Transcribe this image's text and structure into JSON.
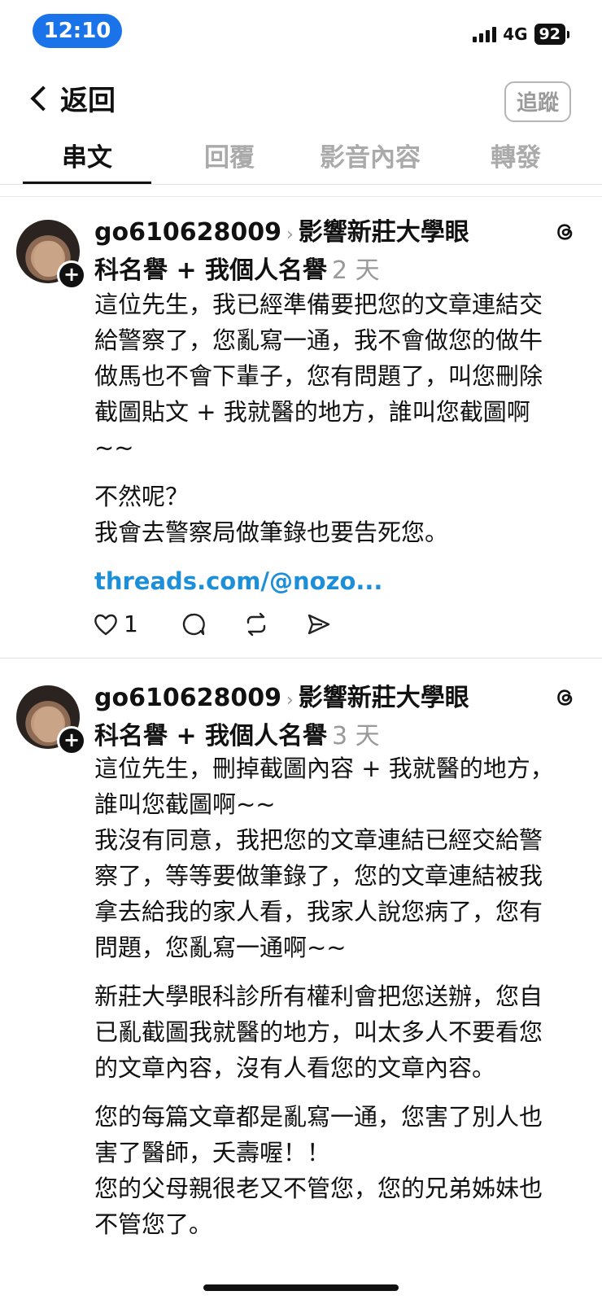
{
  "status_bar": {
    "time": "12:10",
    "network": "4G",
    "battery": "92"
  },
  "header": {
    "back_label": "返回",
    "follow_label": "追蹤"
  },
  "tabs": [
    {
      "label": "串文"
    },
    {
      "label": "回覆"
    },
    {
      "label": "影音內容"
    },
    {
      "label": "轉發"
    }
  ],
  "posts": [
    {
      "username": "go610628009",
      "topic_line1": "影響新莊大學眼",
      "topic_line2": "科名譽 + 我個人名譽",
      "time_ago": "2 天",
      "paragraphs": [
        "這位先生，我已經準備要把您的文章連結交給警察了，您亂寫一通，我不會做您的做牛做馬也不會下輩子，您有問題了，叫您刪除截圖貼文 + 我就醫的地方，誰叫您截圖啊~~",
        "不然呢？",
        "我會去警察局做筆錄也要告死您。"
      ],
      "link": "threads.com/@nozo...",
      "likes": "1"
    },
    {
      "username": "go610628009",
      "topic_line1": "影響新莊大學眼",
      "topic_line2": "科名譽 + 我個人名譽",
      "time_ago": "3 天",
      "paragraphs": [
        "這位先生，刪掉截圖內容 + 我就醫的地方，誰叫您截圖啊~~",
        "我沒有同意，我把您的文章連結已經交給警察了，等等要做筆錄了，您的文章連結被我拿去給我的家人看，我家人說您病了，您有問題，您亂寫一通啊~~",
        "新莊大學眼科診所有權利會把您送辦，您自已亂截圖我就醫的地方，叫太多人不要看您的文章內容，沒有人看您的文章內容。",
        "您的每篇文章都是亂寫一通，您害了別人也害了醫師，夭壽喔！！",
        "您的父母親很老又不管您，您的兄弟姊妹也不管您了。"
      ]
    }
  ]
}
